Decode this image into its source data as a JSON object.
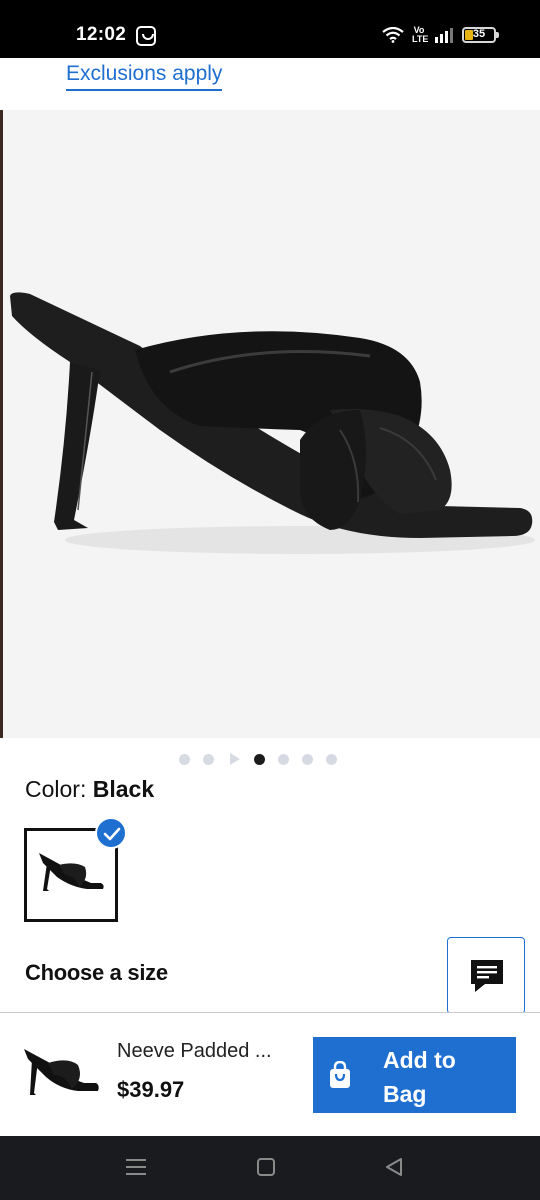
{
  "status_bar": {
    "time": "12:02",
    "network": "Vo LTE",
    "battery": "35"
  },
  "promo": {
    "exclusions_link": "Exclusions apply"
  },
  "gallery": {
    "image_count": 7,
    "active_index": 3
  },
  "color": {
    "label": "Color:",
    "value": "Black"
  },
  "size": {
    "heading": "Choose a size"
  },
  "bottom_bar": {
    "product_name": "Neeve Padded ...",
    "price": "$39.97",
    "add_button": "Add to Bag"
  },
  "colors": {
    "accent": "#1f6fd1",
    "text": "#111111",
    "image_bg": "#f4f4f4",
    "nav_bg": "#1a1b1f"
  }
}
